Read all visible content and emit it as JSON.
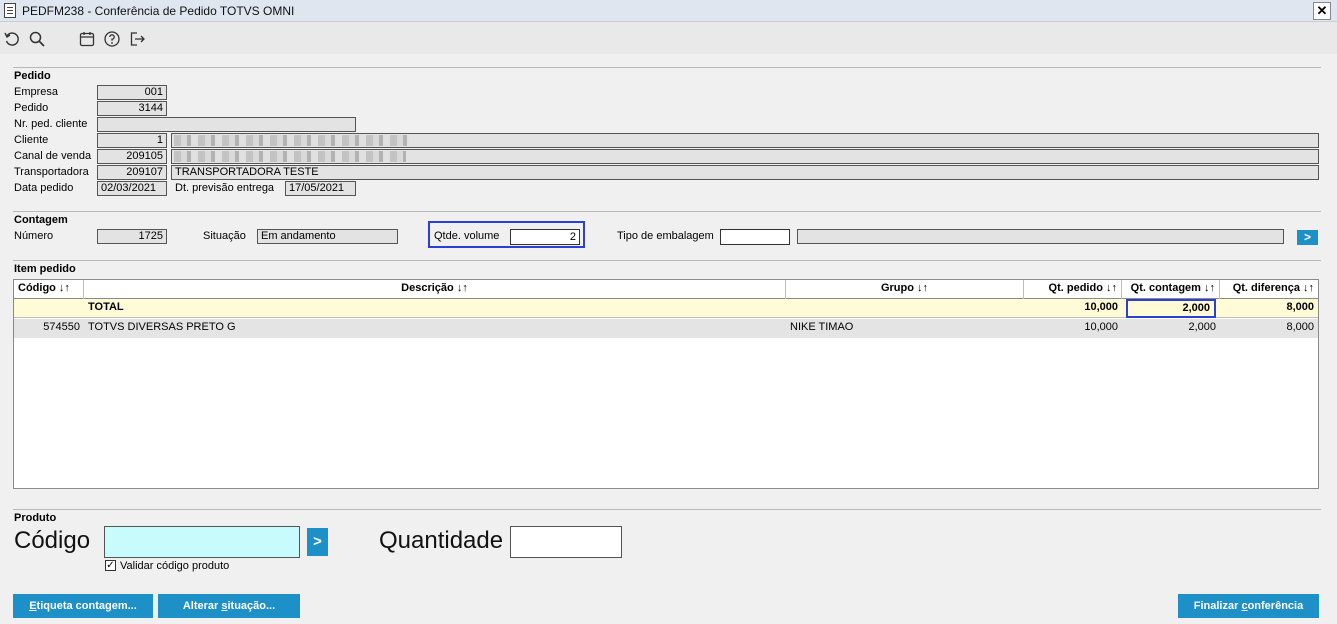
{
  "window": {
    "title": "PEDFM238 - Conferência de Pedido TOTVS OMNI",
    "close_label": "✕"
  },
  "toolbar": {
    "icons": [
      "undo-icon",
      "search-icon",
      "calendar-icon",
      "help-icon",
      "exit-icon"
    ]
  },
  "pedido": {
    "section_title": "Pedido",
    "empresa_label": "Empresa",
    "empresa_value": "001",
    "pedido_label": "Pedido",
    "pedido_value": "3144",
    "nr_ped_cliente_label": "Nr. ped. cliente",
    "nr_ped_cliente_value": "",
    "cliente_label": "Cliente",
    "cliente_code": "1",
    "canal_label": "Canal de venda",
    "canal_code": "209105",
    "transportadora_label": "Transportadora",
    "transportadora_code": "209107",
    "transportadora_name": "TRANSPORTADORA TESTE",
    "data_pedido_label": "Data pedido",
    "data_pedido_value": "02/03/2021",
    "dt_previsao_label": "Dt. previsão entrega",
    "dt_previsao_value": "17/05/2021"
  },
  "contagem": {
    "section_title": "Contagem",
    "numero_label": "Número",
    "numero_value": "1725",
    "situacao_label": "Situação",
    "situacao_value": "Em andamento",
    "qtde_volume_label": "Qtde. volume",
    "qtde_volume_value": "2",
    "tipo_embalagem_label": "Tipo de embalagem",
    "tipo_embalagem_code": "",
    "tipo_embalagem_desc": "",
    "go_label": ">"
  },
  "item_pedido": {
    "section_title": "Item pedido",
    "columns": [
      "Código ↓↑",
      "Descrição ↓↑",
      "Grupo ↓↑",
      "Qt. pedido ↓↑",
      "Qt. contagem ↓↑",
      "Qt. diferença ↓↑"
    ],
    "total_row": {
      "descricao": "TOTAL",
      "qt_pedido": "10,000",
      "qt_contagem": "2,000",
      "qt_diferenca": "8,000"
    },
    "rows": [
      {
        "codigo": "574550",
        "descricao": "TOTVS DIVERSAS PRETO G",
        "grupo": "NIKE TIMAO",
        "qt_pedido": "10,000",
        "qt_contagem": "2,000",
        "qt_diferenca": "8,000"
      }
    ]
  },
  "produto": {
    "section_title": "Produto",
    "codigo_label": "Código",
    "codigo_value": "",
    "quantidade_label": "Quantidade",
    "quantidade_value": "",
    "validar_label": "Validar código produto",
    "validar_checked": "✓",
    "go_label": ">"
  },
  "actions": {
    "etiqueta_prefix": "E",
    "etiqueta_rest": "tiqueta contagem...",
    "alterar_prefix": "Alterar ",
    "alterar_underlined": "s",
    "alterar_rest": "ituação...",
    "finalizar_prefix": "Finalizar ",
    "finalizar_underlined": "c",
    "finalizar_rest": "onferência"
  },
  "colors": {
    "accent": "#1e90c8",
    "highlight": "#2b3fd6",
    "codigo_input_bg": "#c8fcfc",
    "total_row_bg": "#fffbd6"
  }
}
